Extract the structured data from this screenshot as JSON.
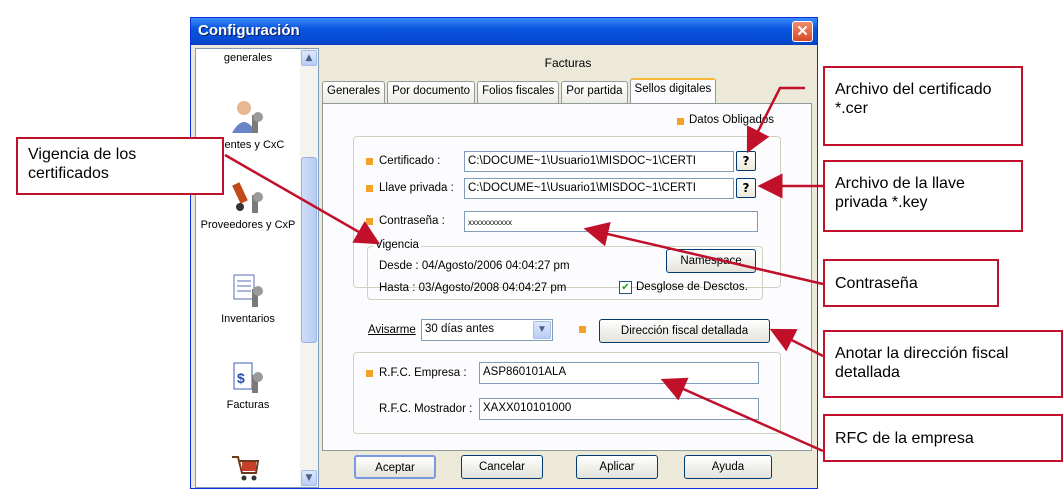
{
  "window": {
    "title": "Configuración",
    "close_glyph": "✕"
  },
  "sidebar": {
    "items": [
      {
        "label": "generales",
        "icon": "settings-icon"
      },
      {
        "label": "Clientes y CxC",
        "icon": "clients-icon"
      },
      {
        "label": "Proveedores y CxP",
        "icon": "suppliers-icon"
      },
      {
        "label": "Inventarios",
        "icon": "inventory-icon"
      },
      {
        "label": "Facturas",
        "icon": "invoices-icon"
      },
      {
        "label": "",
        "icon": "cart-icon"
      }
    ]
  },
  "header": {
    "title": "Facturas"
  },
  "tabs": [
    "Generales",
    "Por documento",
    "Folios fiscales",
    "Por partida",
    "Sellos digitales"
  ],
  "legend": {
    "required": "Datos Obligados"
  },
  "form": {
    "cert_label": "Certificado :",
    "cert_value": "C:\\DOCUME~1\\Usuario1\\MISDOC~1\\CERTI",
    "key_label": "Llave privada :",
    "key_value": "C:\\DOCUME~1\\Usuario1\\MISDOC~1\\CERTI",
    "browse_label": "?",
    "pass_label": "Contraseña :",
    "pass_value": "xxxxxxxxxxx",
    "vigencia_title": "Vigencia",
    "desde": "Desde :  04/Agosto/2006 04:04:27 pm",
    "hasta": "Hasta :  03/Agosto/2008 04:04:27 pm",
    "namespace_btn": "Namespace",
    "desglose_label": "Desglose de Desctos.",
    "avisarme_label": "Avisarme",
    "avisarme_value": "30 días antes",
    "direccion_btn": "Dirección fiscal detallada",
    "rfc_empresa_label": "R.F.C. Empresa :",
    "rfc_empresa_value": "ASP860101ALA",
    "rfc_mostrador_label": "R.F.C. Mostrador :",
    "rfc_mostrador_value": "XAXX010101000"
  },
  "buttons": {
    "accept": "Aceptar",
    "cancel": "Cancelar",
    "apply": "Aplicar",
    "help": "Ayuda"
  },
  "callouts": {
    "cer": "Archivo del certificado *.cer",
    "key": "Archivo de la llave privada *.key",
    "pass": "Contraseña",
    "dir": "Anotar la dirección fiscal detallada",
    "rfc": "RFC de la empresa",
    "vig": "Vigencia de los certificados"
  },
  "colors": {
    "accent": "#c0102a",
    "required": "#f3a128",
    "titlebar": "#0a55df"
  }
}
